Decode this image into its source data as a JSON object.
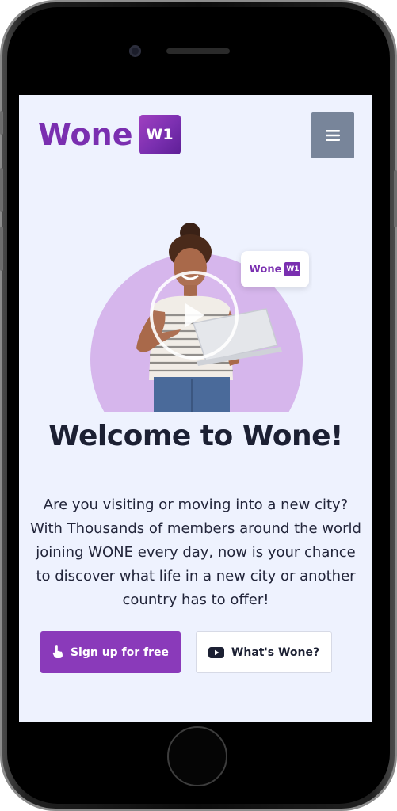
{
  "brand": {
    "name": "Wone",
    "badge": "W1",
    "accent_color": "#7a2fb0",
    "button_color": "#8a3aba"
  },
  "header": {
    "menu_icon": "hamburger-menu-icon"
  },
  "hero": {
    "card_logo_name": "Wone",
    "card_logo_badge": "W1",
    "play_icon": "play-icon"
  },
  "main": {
    "headline": "Welcome to Wone!",
    "intro": "Are you visiting or moving into a new city? With Thousands of members around the world joining WONE every day, now is your chance to discover what life in a new city or another country has to offer!"
  },
  "actions": {
    "signup_label": "Sign up for free",
    "signup_icon": "hand-pointer-icon",
    "whats_label": "What's Wone?",
    "whats_icon": "youtube-icon"
  }
}
